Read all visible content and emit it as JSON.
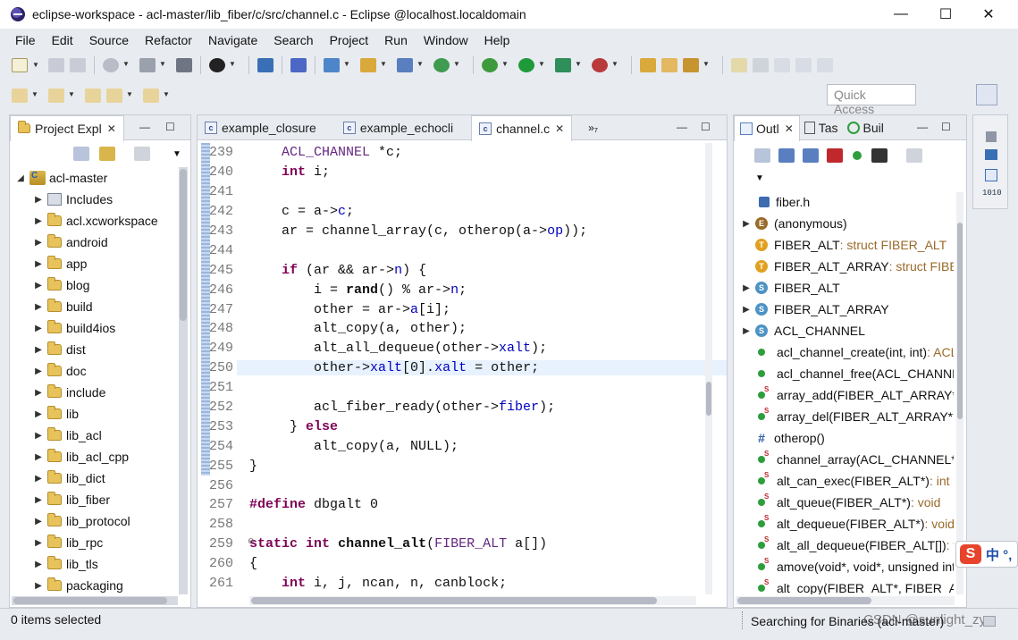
{
  "window": {
    "title": "eclipse-workspace - acl-master/lib_fiber/c/src/channel.c - Eclipse @localhost.localdomain",
    "minimize": "—",
    "maximize": "☐",
    "close": "✕"
  },
  "menu": [
    "File",
    "Edit",
    "Source",
    "Refactor",
    "Navigate",
    "Search",
    "Project",
    "Run",
    "Window",
    "Help"
  ],
  "quick_access": {
    "placeholder": "Quick Access"
  },
  "project_explorer": {
    "tab_label": "Project Expl",
    "root": "acl-master",
    "items": [
      {
        "label": "Includes",
        "kind": "includes"
      },
      {
        "label": "acl.xcworkspace",
        "kind": "folder"
      },
      {
        "label": "android",
        "kind": "folder"
      },
      {
        "label": "app",
        "kind": "folder"
      },
      {
        "label": "blog",
        "kind": "folder"
      },
      {
        "label": "build",
        "kind": "folder"
      },
      {
        "label": "build4ios",
        "kind": "folder"
      },
      {
        "label": "dist",
        "kind": "folder"
      },
      {
        "label": "doc",
        "kind": "folder"
      },
      {
        "label": "include",
        "kind": "folder"
      },
      {
        "label": "lib",
        "kind": "folder"
      },
      {
        "label": "lib_acl",
        "kind": "folder"
      },
      {
        "label": "lib_acl_cpp",
        "kind": "folder"
      },
      {
        "label": "lib_dict",
        "kind": "folder"
      },
      {
        "label": "lib_fiber",
        "kind": "folder"
      },
      {
        "label": "lib_protocol",
        "kind": "folder"
      },
      {
        "label": "lib_rpc",
        "kind": "folder"
      },
      {
        "label": "lib_tls",
        "kind": "folder"
      },
      {
        "label": "packaging",
        "kind": "folder"
      }
    ]
  },
  "editor": {
    "tabs": [
      {
        "label": "example_closure",
        "active": false
      },
      {
        "label": "example_echocli",
        "active": false
      },
      {
        "label": "channel.c",
        "active": true
      }
    ],
    "overflow": "»₇",
    "lines": [
      {
        "n": "239",
        "code": "    ACL_CHANNEL *c;"
      },
      {
        "n": "240",
        "code": "    int i;"
      },
      {
        "n": "241",
        "code": ""
      },
      {
        "n": "242",
        "code": "    c = a->c;"
      },
      {
        "n": "243",
        "code": "    ar = channel_array(c, otherop(a->op));"
      },
      {
        "n": "244",
        "code": ""
      },
      {
        "n": "245",
        "code": "    if (ar && ar->n) {"
      },
      {
        "n": "246",
        "code": "        i = rand() % ar->n;"
      },
      {
        "n": "247",
        "code": "        other = ar->a[i];"
      },
      {
        "n": "248",
        "code": "        alt_copy(a, other);"
      },
      {
        "n": "249",
        "code": "        alt_all_dequeue(other->xalt);"
      },
      {
        "n": "250",
        "code": "        other->xalt[0].xalt = other;"
      },
      {
        "n": "251",
        "code": ""
      },
      {
        "n": "252",
        "code": "        acl_fiber_ready(other->fiber);"
      },
      {
        "n": "253",
        "code": "     } else"
      },
      {
        "n": "254",
        "code": "        alt_copy(a, NULL);"
      },
      {
        "n": "255",
        "code": "}"
      },
      {
        "n": "256",
        "code": ""
      },
      {
        "n": "257",
        "code": "#define dbgalt 0"
      },
      {
        "n": "258",
        "code": ""
      },
      {
        "n": "259",
        "code": "static int channel_alt(FIBER_ALT a[])"
      },
      {
        "n": "260",
        "code": "{"
      },
      {
        "n": "261",
        "code": "    int i, j, ncan, n, canblock;"
      }
    ]
  },
  "outline": {
    "tabs": [
      "Outl",
      "Tas",
      "Buil"
    ],
    "items": [
      {
        "icon": "include",
        "label": "fiber.h",
        "type": "",
        "expand": false
      },
      {
        "icon": "enum",
        "label": "(anonymous)",
        "type": "",
        "expand": true
      },
      {
        "icon": "typedef",
        "label": "FIBER_ALT",
        "type": " : struct FIBER_ALT",
        "expand": false
      },
      {
        "icon": "typedef",
        "label": "FIBER_ALT_ARRAY",
        "type": " : struct FIBER_ALT_ARRAY",
        "expand": false
      },
      {
        "icon": "struct",
        "label": "FIBER_ALT",
        "type": "",
        "expand": true
      },
      {
        "icon": "struct",
        "label": "FIBER_ALT_ARRAY",
        "type": "",
        "expand": true
      },
      {
        "icon": "struct",
        "label": "ACL_CHANNEL",
        "type": "",
        "expand": true
      },
      {
        "icon": "func",
        "label": "acl_channel_create(int, int)",
        "type": " : ACL_CHANNEL*",
        "expand": false
      },
      {
        "icon": "func",
        "label": "acl_channel_free(ACL_CHANNEL*)",
        "type": "",
        "expand": false
      },
      {
        "icon": "sfunc",
        "label": "array_add(FIBER_ALT_ARRAY*, FIBER_ALT*)",
        "type": "",
        "expand": false
      },
      {
        "icon": "sfunc",
        "label": "array_del(FIBER_ALT_ARRAY*, int)",
        "type": "",
        "expand": false
      },
      {
        "icon": "macro",
        "label": "otherop()",
        "type": "",
        "expand": false
      },
      {
        "icon": "sfunc",
        "label": "channel_array(ACL_CHANNEL*, unsigned int)",
        "type": "",
        "expand": false
      },
      {
        "icon": "sfunc",
        "label": "alt_can_exec(FIBER_ALT*)",
        "type": " : int",
        "expand": false
      },
      {
        "icon": "sfunc",
        "label": "alt_queue(FIBER_ALT*)",
        "type": " : void",
        "expand": false
      },
      {
        "icon": "sfunc",
        "label": "alt_dequeue(FIBER_ALT*)",
        "type": " : void",
        "expand": false
      },
      {
        "icon": "sfunc",
        "label": "alt_all_dequeue(FIBER_ALT[])",
        "type": " : void",
        "expand": false
      },
      {
        "icon": "sfunc",
        "label": "amove(void*, void*, unsigned int)",
        "type": "",
        "expand": false
      },
      {
        "icon": "sfunc",
        "label": "alt_copy(FIBER_ALT*, FIBER_ALT*)",
        "type": "",
        "expand": false
      }
    ]
  },
  "status": {
    "selection": "0 items selected",
    "progress": "Searching for Binaries (acl-master)",
    "watermark": "CSDN @sunlight_zyy"
  },
  "ime": {
    "label": "中 °,"
  }
}
